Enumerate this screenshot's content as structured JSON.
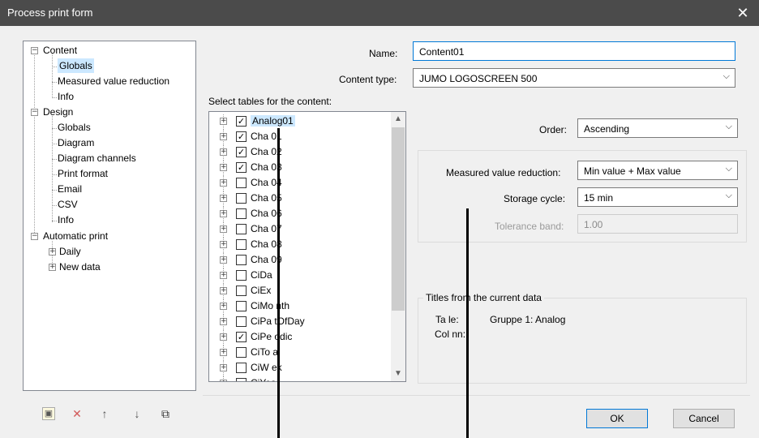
{
  "window": {
    "title": "Process print form",
    "close_glyph": "✕"
  },
  "tree": {
    "content": "Content",
    "content_globals": "Globals",
    "content_mvr": "Measured value reduction",
    "content_info": "Info",
    "design": "Design",
    "design_globals": "Globals",
    "design_diagram": "Diagram",
    "design_channels": "Diagram channels",
    "design_print_format": "Print format",
    "design_email": "Email",
    "design_csv": "CSV",
    "design_info": "Info",
    "auto": "Automatic print",
    "auto_daily": "Daily",
    "auto_new_data": "New data",
    "minus": "−",
    "plus": "+"
  },
  "form": {
    "name_label": "Name:",
    "name_value": "Content01",
    "content_type_label": "Content type:",
    "content_type_value": "JUMO LOGOSCREEN 500",
    "select_tables_label": "Select tables for the content:",
    "order_label": "Order:",
    "order_value": "Ascending",
    "mvr_label": "Measured value reduction:",
    "mvr_value": "Min value + Max value",
    "storage_cycle_label": "Storage cycle:",
    "storage_cycle_value": "15 min",
    "tolerance_label": "Tolerance band:",
    "tolerance_value": "1.00",
    "titles_group_label": "Titles from the current data",
    "table_label": "Ta  le:",
    "table_value": "Gruppe 1: Analog",
    "column_label": "Col  nn:",
    "combo_arrow": "⌵"
  },
  "tables": [
    {
      "name": "Analog01",
      "checked": true,
      "selected": true
    },
    {
      "name": "Cha  01",
      "checked": true
    },
    {
      "name": "Cha  02",
      "checked": true
    },
    {
      "name": "Cha  03",
      "checked": true
    },
    {
      "name": "Cha  04",
      "checked": false
    },
    {
      "name": "Cha  05",
      "checked": false
    },
    {
      "name": "Cha  06",
      "checked": false
    },
    {
      "name": "Cha  07",
      "checked": false
    },
    {
      "name": "Cha  08",
      "checked": false
    },
    {
      "name": "Cha  09",
      "checked": false
    },
    {
      "name": "CiDa",
      "checked": false
    },
    {
      "name": "CiEx",
      "checked": false
    },
    {
      "name": "CiMo  nth",
      "checked": false
    },
    {
      "name": "CiPa  tOfDay",
      "checked": false
    },
    {
      "name": "CiPe  odic",
      "checked": true
    },
    {
      "name": "CiTo  al",
      "checked": false
    },
    {
      "name": "CiW  ek",
      "checked": false
    },
    {
      "name": "CiYea",
      "checked": false
    }
  ],
  "scroll": {
    "up": "▲",
    "down": "▼"
  },
  "toolbar": {
    "new_icon": "▣",
    "delete_icon": "✕",
    "up_icon": "↑",
    "down_icon": "↓",
    "copy_icon": "⧉"
  },
  "buttons": {
    "ok": "OK",
    "cancel": "Cancel"
  },
  "colors": {
    "titlebar": "#4b4b4b",
    "accent": "#0078d7",
    "selection": "#cce8ff"
  }
}
